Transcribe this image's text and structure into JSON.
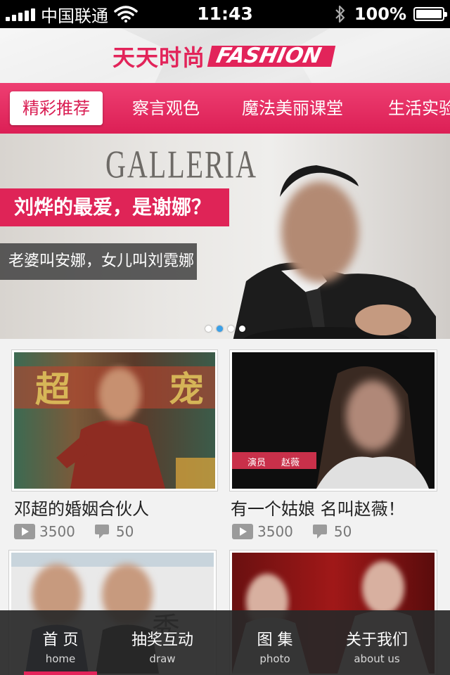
{
  "status_bar": {
    "carrier": "中国联通",
    "time": "11:43",
    "battery_percent": "100%",
    "battery_level": 1.0
  },
  "header": {
    "logo_cn": "天天时尚",
    "logo_en": "FASHION",
    "accent_color": "#e2245a"
  },
  "tabs": [
    {
      "label": "精彩推荐",
      "active": true
    },
    {
      "label": "察言观色",
      "active": false
    },
    {
      "label": "魔法美丽课堂",
      "active": false
    },
    {
      "label": "生活实验",
      "active": false
    }
  ],
  "banner": {
    "wall_text": "GALLERIA",
    "headline": "刘烨的最爱，是谢娜？",
    "subtitle": "老婆叫安娜，女儿叫刘霓娜",
    "page_count": 4,
    "active_page": 2
  },
  "cards": [
    {
      "title": "邓超的婚姻合伙人",
      "plays": "3500",
      "comments": "50"
    },
    {
      "title": "有一个姑娘 名叫赵薇！",
      "plays": "3500",
      "comments": "50",
      "caption_role": "演员",
      "caption_name": "赵薇"
    },
    {
      "title": "",
      "plays": "",
      "comments": ""
    },
    {
      "title": "",
      "plays": "",
      "comments": ""
    }
  ],
  "bottom_nav": [
    {
      "cn": "首 页",
      "en": "home",
      "active": true
    },
    {
      "cn": "抽奖互动",
      "en": "draw",
      "active": false
    },
    {
      "cn": "图 集",
      "en": "photo",
      "active": false
    },
    {
      "cn": "关于我们",
      "en": "about us",
      "active": false
    }
  ]
}
